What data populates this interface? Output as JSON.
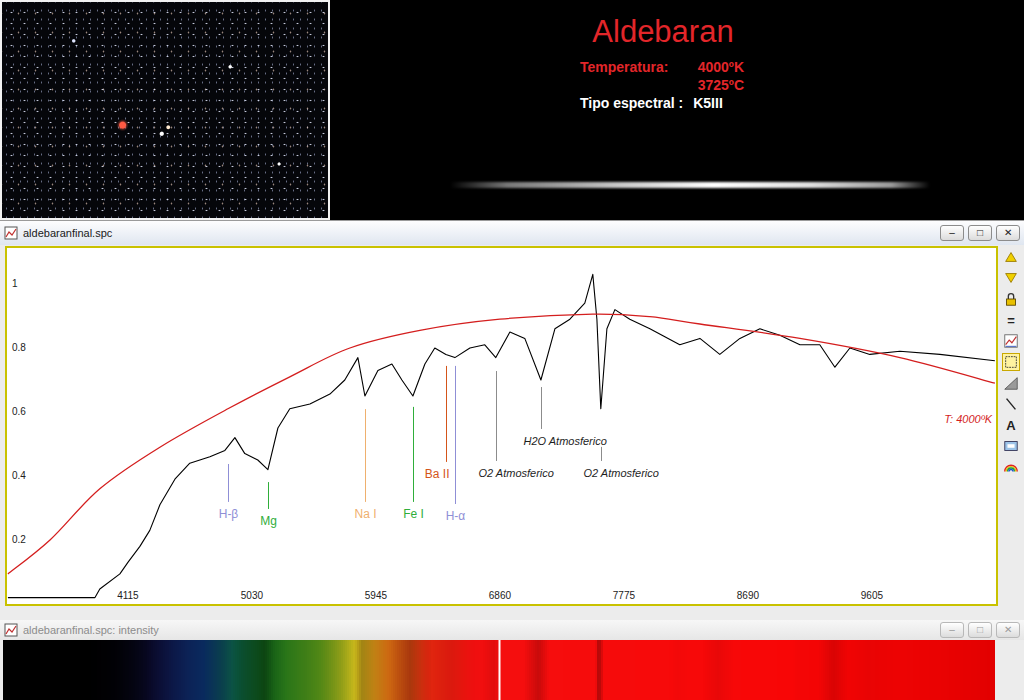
{
  "target": {
    "name": "Aldebaran",
    "temperature_label": "Temperatura:",
    "temperature_k": "4000ºK",
    "temperature_c": "3725ºC",
    "spectral_type_label": "Tipo espectral :",
    "spectral_type": "K5III"
  },
  "spectrum_window": {
    "title": "aldebaranfinal.spc",
    "active": true,
    "buttons": [
      "–",
      "□",
      "✕"
    ],
    "chart": {
      "x_ticks": [
        {
          "label": "4115",
          "value": 4115
        },
        {
          "label": "5030",
          "value": 5030
        },
        {
          "label": "5945",
          "value": 5945
        },
        {
          "label": "6860",
          "value": 6860
        },
        {
          "label": "7775",
          "value": 7775
        },
        {
          "label": "8690",
          "value": 8690
        },
        {
          "label": "9605",
          "value": 9605
        }
      ],
      "y_ticks": [
        {
          "label": "1",
          "value": 1
        },
        {
          "label": "0.8",
          "value": 0.8
        },
        {
          "label": "0.6",
          "value": 0.6
        },
        {
          "label": "0.4",
          "value": 0.4
        },
        {
          "label": "0.2",
          "value": 0.2
        }
      ],
      "series": [
        {
          "color": "#000000",
          "wavelengths": [
            3230,
            3872,
            3908,
            4056,
            4115,
            4204,
            4277,
            4351,
            4462,
            4572,
            4720,
            4831,
            4905,
            4978,
            5074,
            5148,
            5222,
            5310,
            5458,
            5606,
            5716,
            5812,
            5864,
            5960,
            6063,
            6137,
            6218,
            6307,
            6380,
            6462,
            6528,
            6639,
            6749,
            6830,
            6934,
            7044,
            7163,
            7266,
            7377,
            7487,
            7546,
            7576,
            7605,
            7650,
            7709,
            7819,
            7967,
            8188,
            8336,
            8483,
            8631,
            8779,
            8926,
            9074,
            9221,
            9332,
            9443,
            9590,
            9812,
            10107,
            10513
          ],
          "values": [
            0.02,
            0.02,
            0.047,
            0.094,
            0.13,
            0.18,
            0.23,
            0.31,
            0.39,
            0.44,
            0.46,
            0.48,
            0.52,
            0.47,
            0.45,
            0.42,
            0.55,
            0.61,
            0.625,
            0.656,
            0.7,
            0.77,
            0.65,
            0.73,
            0.75,
            0.7,
            0.65,
            0.75,
            0.8,
            0.78,
            0.77,
            0.8,
            0.81,
            0.77,
            0.85,
            0.83,
            0.7,
            0.86,
            0.89,
            0.94,
            1.03,
            0.89,
            0.61,
            0.86,
            0.92,
            0.89,
            0.86,
            0.81,
            0.83,
            0.78,
            0.83,
            0.86,
            0.84,
            0.81,
            0.81,
            0.74,
            0.8,
            0.78,
            0.79,
            0.78,
            0.76
          ]
        },
        {
          "color": "#d41e1e",
          "label": "T: 4000ºK",
          "wavelengths": [
            3230,
            3540,
            3908,
            4351,
            4853,
            5310,
            5753,
            6270,
            6860,
            7546,
            7967,
            8336,
            9074,
            9812,
            10513
          ],
          "values": [
            0.094,
            0.2,
            0.36,
            0.49,
            0.61,
            0.71,
            0.8,
            0.855,
            0.89,
            0.906,
            0.898,
            0.875,
            0.83,
            0.77,
            0.69
          ]
        }
      ],
      "lines": [
        {
          "label": "H-β",
          "kind": "element",
          "color": "#8f8fd6",
          "wavelength": 4853,
          "top": 0.4375,
          "bottom": 0.319
        },
        {
          "label": "Mg",
          "kind": "element",
          "color": "#2fae3a",
          "wavelength": 5148,
          "top": 0.381,
          "bottom": 0.297
        },
        {
          "label": "Na I",
          "kind": "element",
          "color": "#efb06e",
          "wavelength": 5864,
          "top": 0.609,
          "bottom": 0.319
        },
        {
          "label": "Fe I",
          "kind": "element",
          "color": "#2fae3a",
          "wavelength": 6218,
          "top": 0.616,
          "bottom": 0.319
        },
        {
          "label": "Ba II",
          "kind": "element-left",
          "color": "#d4551a",
          "wavelength": 6462,
          "top": 0.744,
          "bottom": 0.444
        },
        {
          "label": "H-α",
          "kind": "element",
          "color": "#8f8fd6",
          "wavelength": 6528,
          "top": 0.744,
          "bottom": 0.3125
        },
        {
          "label": "O2  Atmosferico",
          "kind": "atmospheric",
          "color": "#8c8c8c",
          "wavelength": 6830,
          "top": 0.728,
          "bottom": 0.447
        },
        {
          "label": "H2O Atmosferico",
          "kind": "atmospheric",
          "color": "#8c8c8c",
          "wavelength": 7163,
          "top": 0.678,
          "bottom": 0.547
        },
        {
          "label": "O2 Atmosferico",
          "kind": "atmospheric",
          "color": "#8c8c8c",
          "wavelength": 7605,
          "top": 0.491,
          "bottom": 0.447
        }
      ]
    },
    "toolbar": [
      {
        "kind": "up",
        "selected": false
      },
      {
        "kind": "down",
        "selected": false
      },
      {
        "kind": "lock",
        "selected": false
      },
      {
        "kind": "glyph",
        "glyph": "=",
        "selected": false
      },
      {
        "kind": "chart",
        "selected": false
      },
      {
        "kind": "frame",
        "selected": true
      },
      {
        "kind": "ramp",
        "selected": false
      },
      {
        "kind": "line",
        "selected": false
      },
      {
        "kind": "glyph",
        "glyph": "A",
        "selected": false
      },
      {
        "kind": "screen",
        "selected": false
      },
      {
        "kind": "rainbow",
        "selected": false
      }
    ]
  },
  "intensity_window": {
    "title": "aldebaranfinal.spc: intensity",
    "active": false,
    "buttons": [
      "–",
      "□",
      "✕"
    ],
    "cursor_wavelength": 6876
  }
}
